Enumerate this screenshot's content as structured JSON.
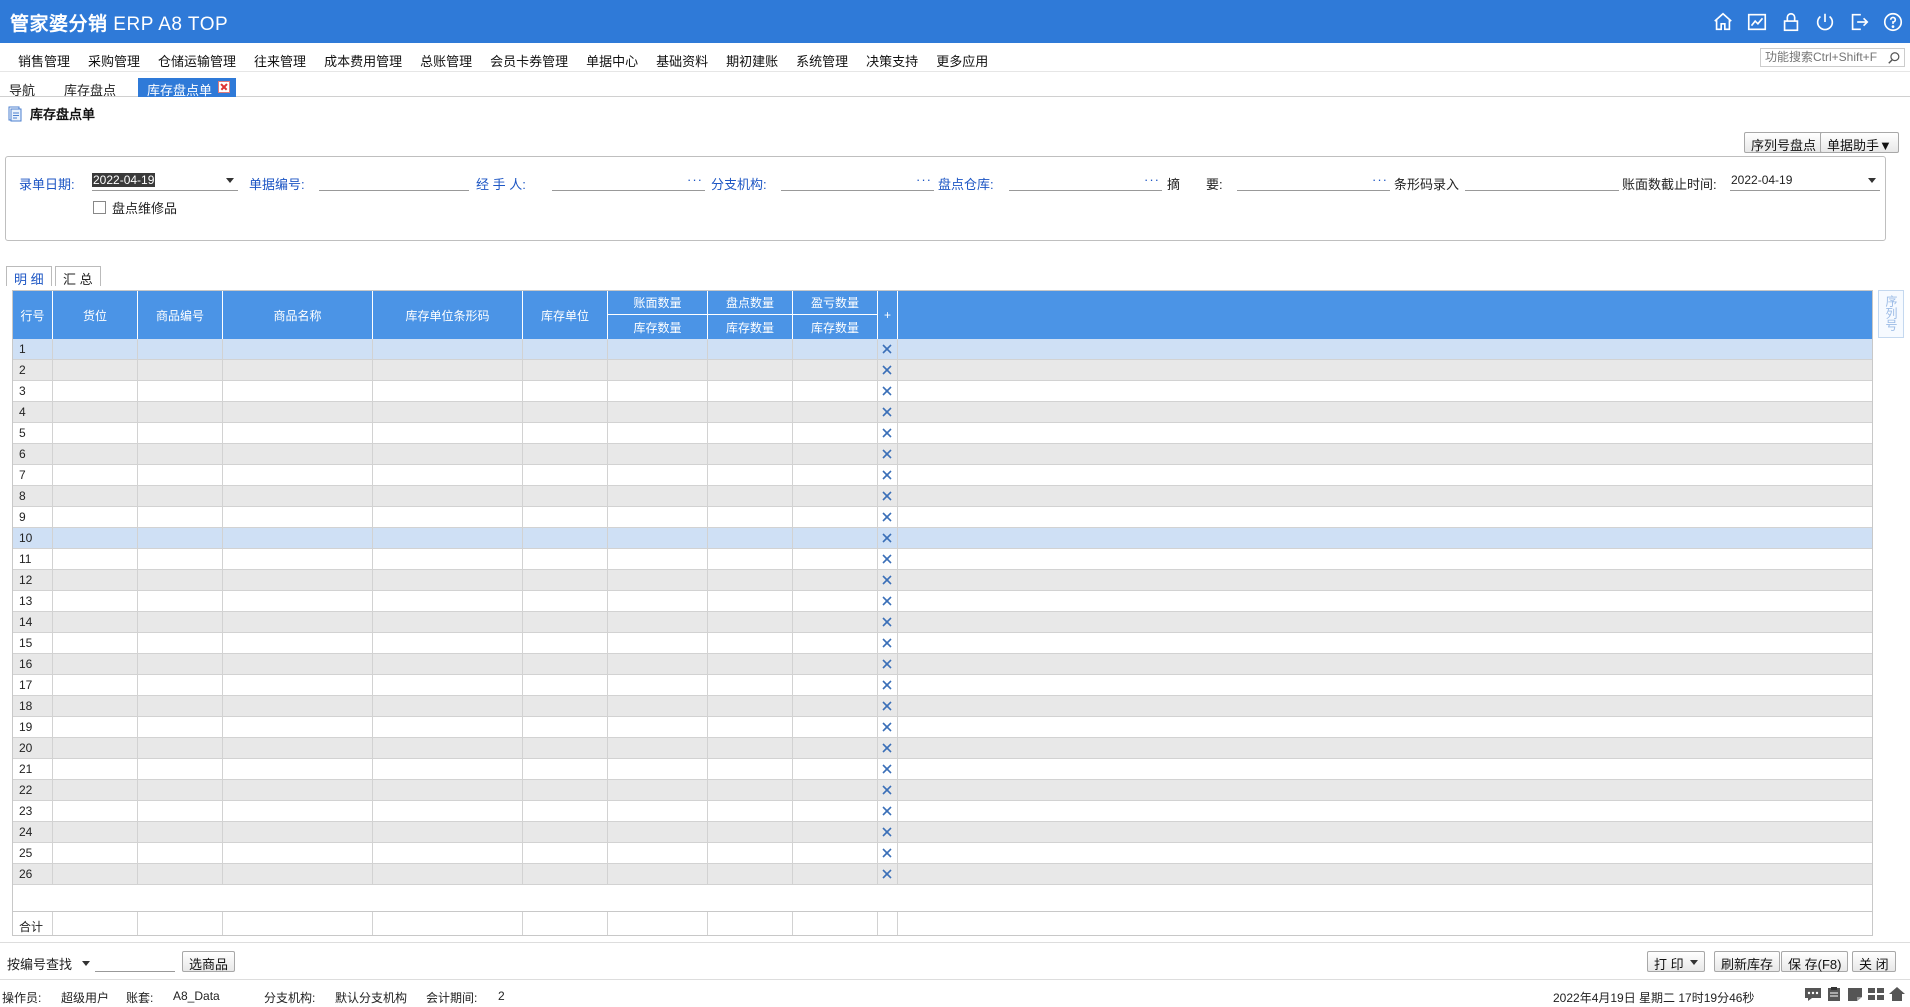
{
  "app": {
    "title_cn": "管家婆分销",
    "title_en": "ERP A8 TOP"
  },
  "menus": [
    "销售管理",
    "采购管理",
    "仓储运输管理",
    "往来管理",
    "成本费用管理",
    "总账管理",
    "会员卡券管理",
    "单据中心",
    "基础资料",
    "期初建账",
    "系统管理",
    "决策支持",
    "更多应用"
  ],
  "func_search": {
    "placeholder": "功能搜索Ctrl+Shift+F"
  },
  "tabs": [
    {
      "label": "导航"
    },
    {
      "label": "库存盘点"
    },
    {
      "label": "库存盘点单"
    }
  ],
  "doc": {
    "title": "库存盘点单"
  },
  "toolbar": {
    "serial_check": "序列号盘点",
    "doc_helper": "单据助手▼"
  },
  "form": {
    "date_label": "录单日期:",
    "date_value": "2022-04-19",
    "doc_no_label": "单据编号:",
    "handler_label": "经 手 人:",
    "branch_label": "分支机构:",
    "warehouse_label": "盘点仓库:",
    "summary_label": "摘　　要:",
    "barcode_label": "条形码录入",
    "cutoff_label": "账面数截止时间:",
    "cutoff_value": "2022-04-19",
    "repair_checkbox": "盘点维修品",
    "dots": "···"
  },
  "subtabs": [
    "明 细",
    "汇 总"
  ],
  "grid": {
    "headers": {
      "row_no": "行号",
      "location": "货位",
      "product_code": "商品编号",
      "product_name": "商品名称",
      "barcode": "库存单位条形码",
      "unit": "库存单位",
      "book_qty": "账面数量",
      "count_qty": "盘点数量",
      "diff_qty": "盈亏数量",
      "stock_qty": "库存数量",
      "plus": "+"
    },
    "rows": [
      "1",
      "2",
      "3",
      "4",
      "5",
      "6",
      "7",
      "8",
      "9",
      "10",
      "11",
      "12",
      "13",
      "14",
      "15",
      "16",
      "17",
      "18",
      "19",
      "20",
      "21",
      "22",
      "23",
      "24",
      "25",
      "26"
    ],
    "highlight_rows": [
      1,
      10
    ],
    "footer_total": "合计"
  },
  "side_panel": {
    "label": "序列号"
  },
  "bottom": {
    "lookup_label": "按编号查找",
    "select_product": "选商品",
    "print": "打 印",
    "refresh_stock": "刷新库存",
    "save": "保 存(F8)",
    "close": "关 闭"
  },
  "status": {
    "operator_label": "操作员:",
    "operator": "超级用户",
    "account_label": "账套:",
    "account": "A8_Data",
    "branch_label": "分支机构:",
    "branch": "默认分支机构",
    "period_label": "会计期间:",
    "period": "2",
    "datetime": "2022年4月19日 星期二 17时19分46秒"
  },
  "colors": {
    "brand": "#2f7ad8",
    "grid_header": "#4b94e6",
    "label_blue": "#1d56c4"
  }
}
